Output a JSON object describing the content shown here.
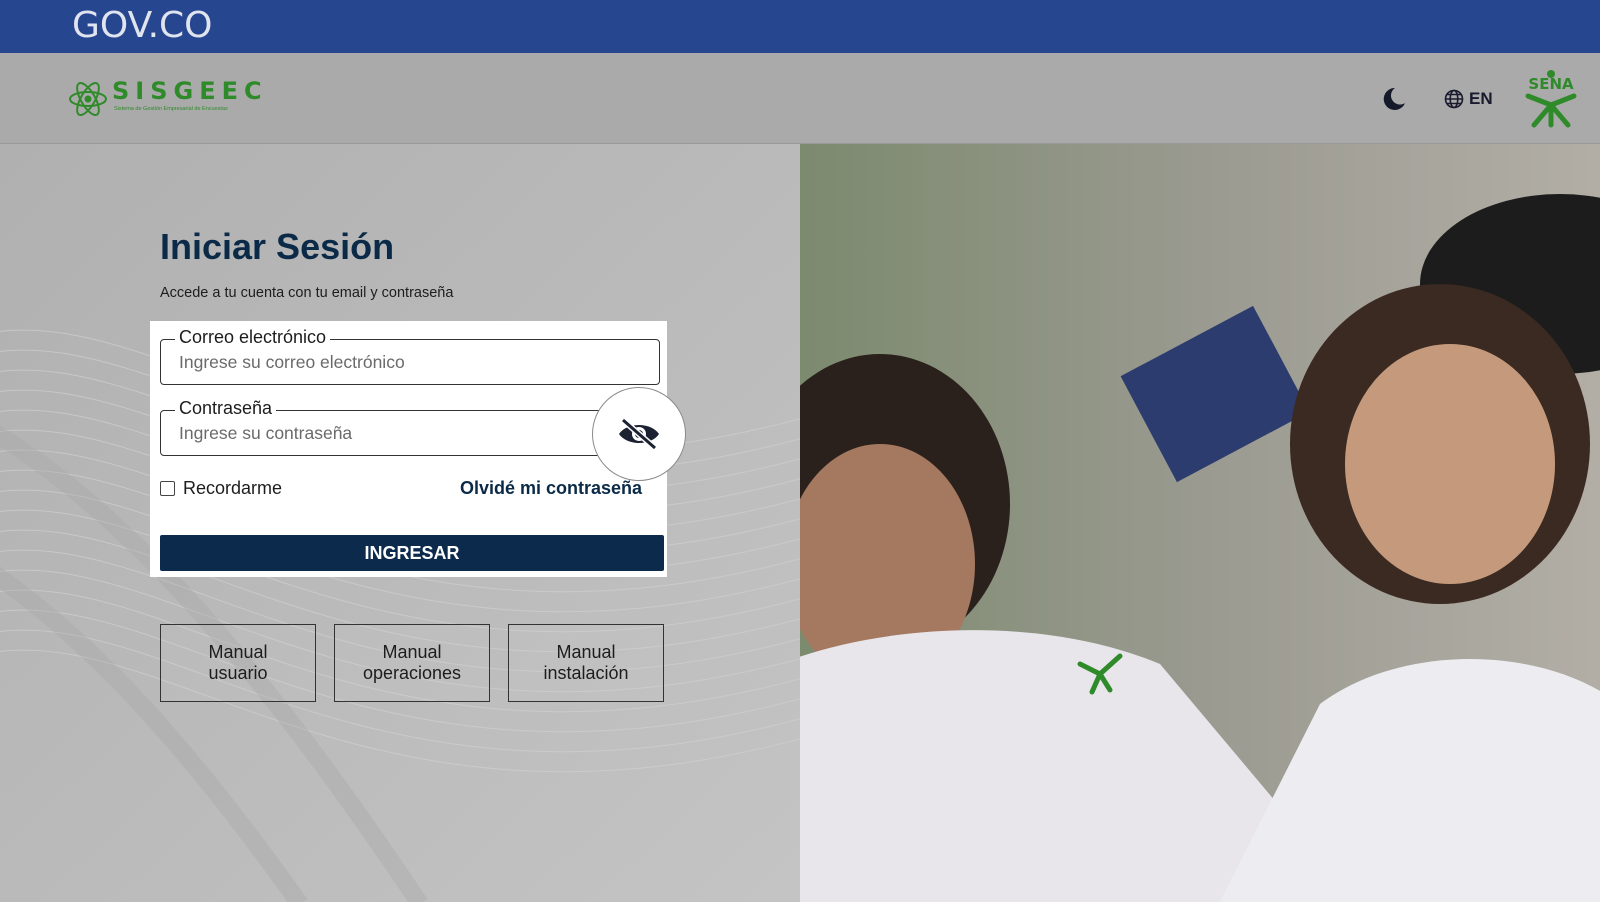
{
  "gov_bar": {
    "logo_text": "GOV.CO"
  },
  "header": {
    "brand_name": "SISGEEC",
    "brand_subtitle": "Sistema de Gestión Empresarial de Encuestas",
    "theme_icon": "moon-icon",
    "language_label": "EN",
    "language_icon": "globe-icon",
    "partner_logo": "SENA"
  },
  "login": {
    "title": "Iniciar Sesión",
    "subtitle": "Accede a tu cuenta con tu email y contraseña",
    "email": {
      "label": "Correo electrónico",
      "placeholder": "Ingrese su correo electrónico",
      "value": ""
    },
    "password": {
      "label": "Contraseña",
      "placeholder": "Ingrese su contraseña",
      "value": ""
    },
    "password_toggle_icon": "eye-off-icon",
    "remember_label": "Recordarme",
    "remember_checked": false,
    "forgot_label": "Olvidé mi contraseña",
    "submit_label": "INGRESAR"
  },
  "manuals": [
    {
      "label": "Manual usuario"
    },
    {
      "label": "Manual operaciones"
    },
    {
      "label": "Manual instalación"
    }
  ],
  "colors": {
    "gov_bar": "#26468f",
    "brand_green": "#2f8a2a",
    "primary_navy": "#0b2a4c"
  }
}
